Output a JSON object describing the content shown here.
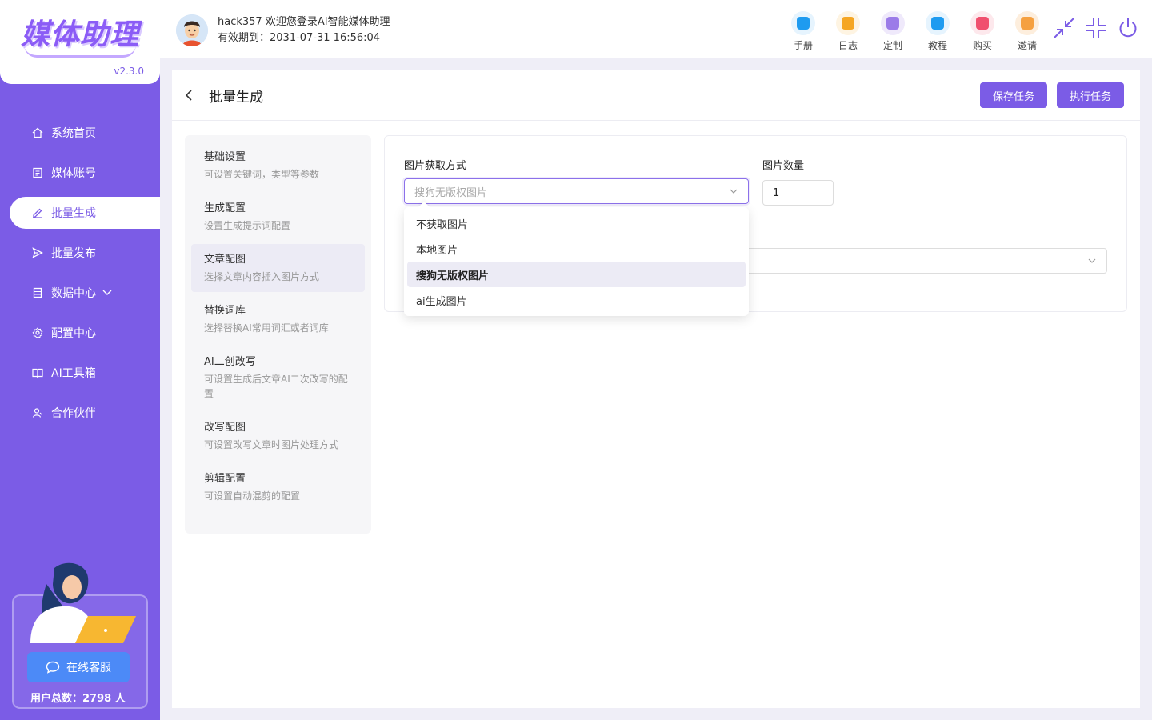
{
  "app": {
    "logo_text": "媒体助理",
    "version": "v2.3.0"
  },
  "sidebar": {
    "items": [
      {
        "label": "系统首页",
        "icon": "home-icon"
      },
      {
        "label": "媒体账号",
        "icon": "account-icon"
      },
      {
        "label": "批量生成",
        "icon": "edit-icon"
      },
      {
        "label": "批量发布",
        "icon": "send-icon"
      },
      {
        "label": "数据中心",
        "icon": "database-icon"
      },
      {
        "label": "配置中心",
        "icon": "gear-icon"
      },
      {
        "label": "AI工具箱",
        "icon": "book-icon"
      },
      {
        "label": "合作伙伴",
        "icon": "partner-icon"
      }
    ],
    "active_index": 2,
    "service_button": "在线客服",
    "users_total": "用户总数：2798 人"
  },
  "header": {
    "welcome": "hack357 欢迎您登录AI智能媒体助理",
    "expiry": "有效期到：2031-07-31 16:56:04",
    "tools": [
      {
        "label": "手册",
        "icon": "manual-icon",
        "color": "#1e9bf0"
      },
      {
        "label": "日志",
        "icon": "log-icon",
        "color": "#f5a623"
      },
      {
        "label": "定制",
        "icon": "custom-icon",
        "color": "#9b7be8"
      },
      {
        "label": "教程",
        "icon": "tutorial-icon",
        "color": "#1e9bf0"
      },
      {
        "label": "购买",
        "icon": "buy-icon",
        "color": "#f0506e"
      },
      {
        "label": "邀请",
        "icon": "invite-icon",
        "color": "#f5a040"
      }
    ]
  },
  "page": {
    "title": "批量生成",
    "save_label": "保存任务",
    "run_label": "执行任务"
  },
  "steps": [
    {
      "title": "基础设置",
      "desc": "可设置关键词，类型等参数"
    },
    {
      "title": "生成配置",
      "desc": "设置生成提示词配置"
    },
    {
      "title": "文章配图",
      "desc": "选择文章内容插入图片方式"
    },
    {
      "title": "替换词库",
      "desc": "选择替换AI常用词汇或者词库"
    },
    {
      "title": "AI二创改写",
      "desc": "可设置生成后文章AI二次改写的配置"
    },
    {
      "title": "改写配图",
      "desc": "可设置改写文章时图片处理方式"
    },
    {
      "title": "剪辑配置",
      "desc": "可设置自动混剪的配置"
    }
  ],
  "active_step": 2,
  "form": {
    "image_source_label": "图片获取方式",
    "image_source_placeholder": "搜狗无版权图片",
    "image_count_label": "图片数量",
    "image_count_value": "1",
    "dropdown_options": [
      "不获取图片",
      "本地图片",
      "搜狗无版权图片",
      "ai生成图片"
    ],
    "selected_option": 2
  },
  "colors": {
    "primary": "#7b5ce6",
    "service": "#4c8af7"
  }
}
